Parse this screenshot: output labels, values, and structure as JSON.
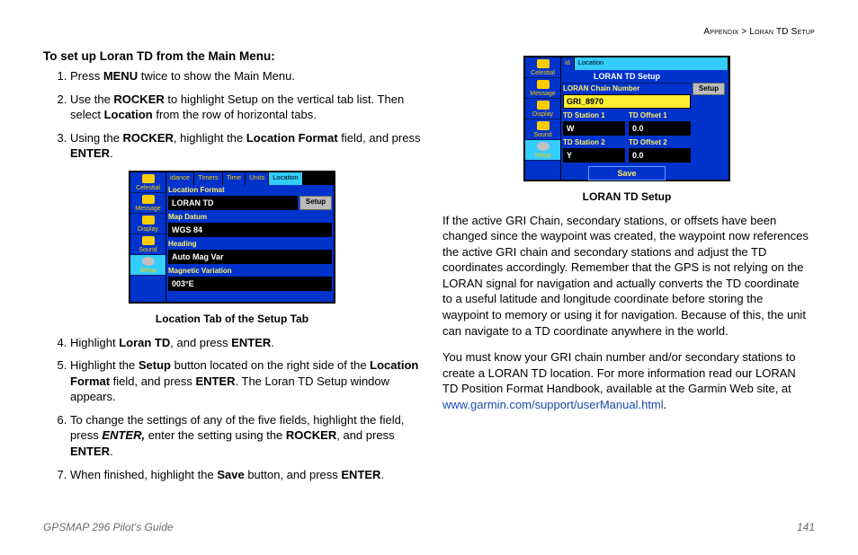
{
  "breadcrumb": {
    "section": "Appendix",
    "sep": ">",
    "page": "Loran TD Setup"
  },
  "heading": "To set up Loran TD from the Main Menu:",
  "steps_a": [
    {
      "pre": "Press ",
      "b1": "MENU",
      "post": " twice to show the Main Menu."
    },
    {
      "pre": "Use the ",
      "b1": "ROCKER",
      "mid": " to highlight Setup on the vertical tab list. Then select ",
      "b2": "Location",
      "post": " from the row of horizontal tabs."
    },
    {
      "pre": "Using the ",
      "b1": "ROCKER",
      "mid": ", highlight the ",
      "b2": "Location Format",
      "mid2": " field, and press ",
      "b3": "ENTER",
      "post": "."
    }
  ],
  "fig1": {
    "tabs": [
      "idance",
      "Timers",
      "Time",
      "Units",
      "Location"
    ],
    "active_tab": 4,
    "sidebar": [
      "Celestial",
      "Message",
      "Display",
      "Sound",
      "Setup"
    ],
    "rows": [
      {
        "label": "Location Format",
        "value": "LORAN TD",
        "button": "Setup"
      },
      {
        "label": "Map Datum",
        "value": "WGS 84"
      },
      {
        "label": "Heading",
        "value": "Auto Mag Var"
      },
      {
        "label": "Magnetic Variation",
        "value": "003°E"
      }
    ],
    "caption": "Location Tab of the Setup Tab"
  },
  "steps_b": [
    {
      "pre": "Highlight ",
      "b1": "Loran TD",
      "mid": ", and press ",
      "b2": "ENTER",
      "post": "."
    },
    {
      "pre": "Highlight the ",
      "b1": "Setup",
      "mid": " button located on the right side of the ",
      "b2": "Location Format",
      "mid2": " field, and press ",
      "b3": "ENTER",
      "post": ". The Loran TD Setup window appears."
    },
    {
      "pre": "To change the settings of any of the five fields, highlight the field, press ",
      "b1": "ENTER,",
      "mid": " enter the setting using the ",
      "b2": "ROCKER",
      "mid2": ", and press ",
      "b3": "ENTER",
      "post": "."
    },
    {
      "pre": "When finished, highlight the ",
      "b1": "Save",
      "mid": " button, and press ",
      "b2": "ENTER",
      "post": "."
    }
  ],
  "fig2": {
    "title": "LORAN TD Setup",
    "sidebar": [
      "Celestial",
      "Message",
      "Display",
      "Sound",
      "Setup"
    ],
    "tab_left": "id",
    "tab_right": "Location",
    "setup_btn": "Setup",
    "chain_label": "LORAN Chain Number",
    "chain_value": "GRI_8970",
    "station1_label": "TD Station 1",
    "offset1_label": "TD Offset 1",
    "station1_value": "W",
    "offset1_value": "0.0",
    "station2_label": "TD Station 2",
    "offset2_label": "TD Offset 2",
    "station2_value": "Y",
    "offset2_value": "0.0",
    "save": "Save",
    "caption": "LORAN TD Setup"
  },
  "para1": "If the active GRI Chain, secondary stations, or offsets have been changed since the waypoint was created, the waypoint now references the active GRI chain and secondary stations and adjust the TD coordinates accordingly. Remember that the GPS is not relying on the LORAN signal for navigation and actually converts the TD coordinate to a useful latitude and longitude coordinate before storing the waypoint to memory or using it for navigation. Because of this, the unit can navigate to a TD coordinate anywhere in the world.",
  "para2_a": "You must know your GRI chain number and/or secondary stations to create a LORAN TD location. For more information read our LORAN TD Position Format Handbook, available at the Garmin Web site, at ",
  "para2_link": "www.garmin.com/support/userManual.html",
  "para2_b": ".",
  "footer": {
    "guide": "GPSMAP 296 Pilot's Guide",
    "page": "141"
  }
}
